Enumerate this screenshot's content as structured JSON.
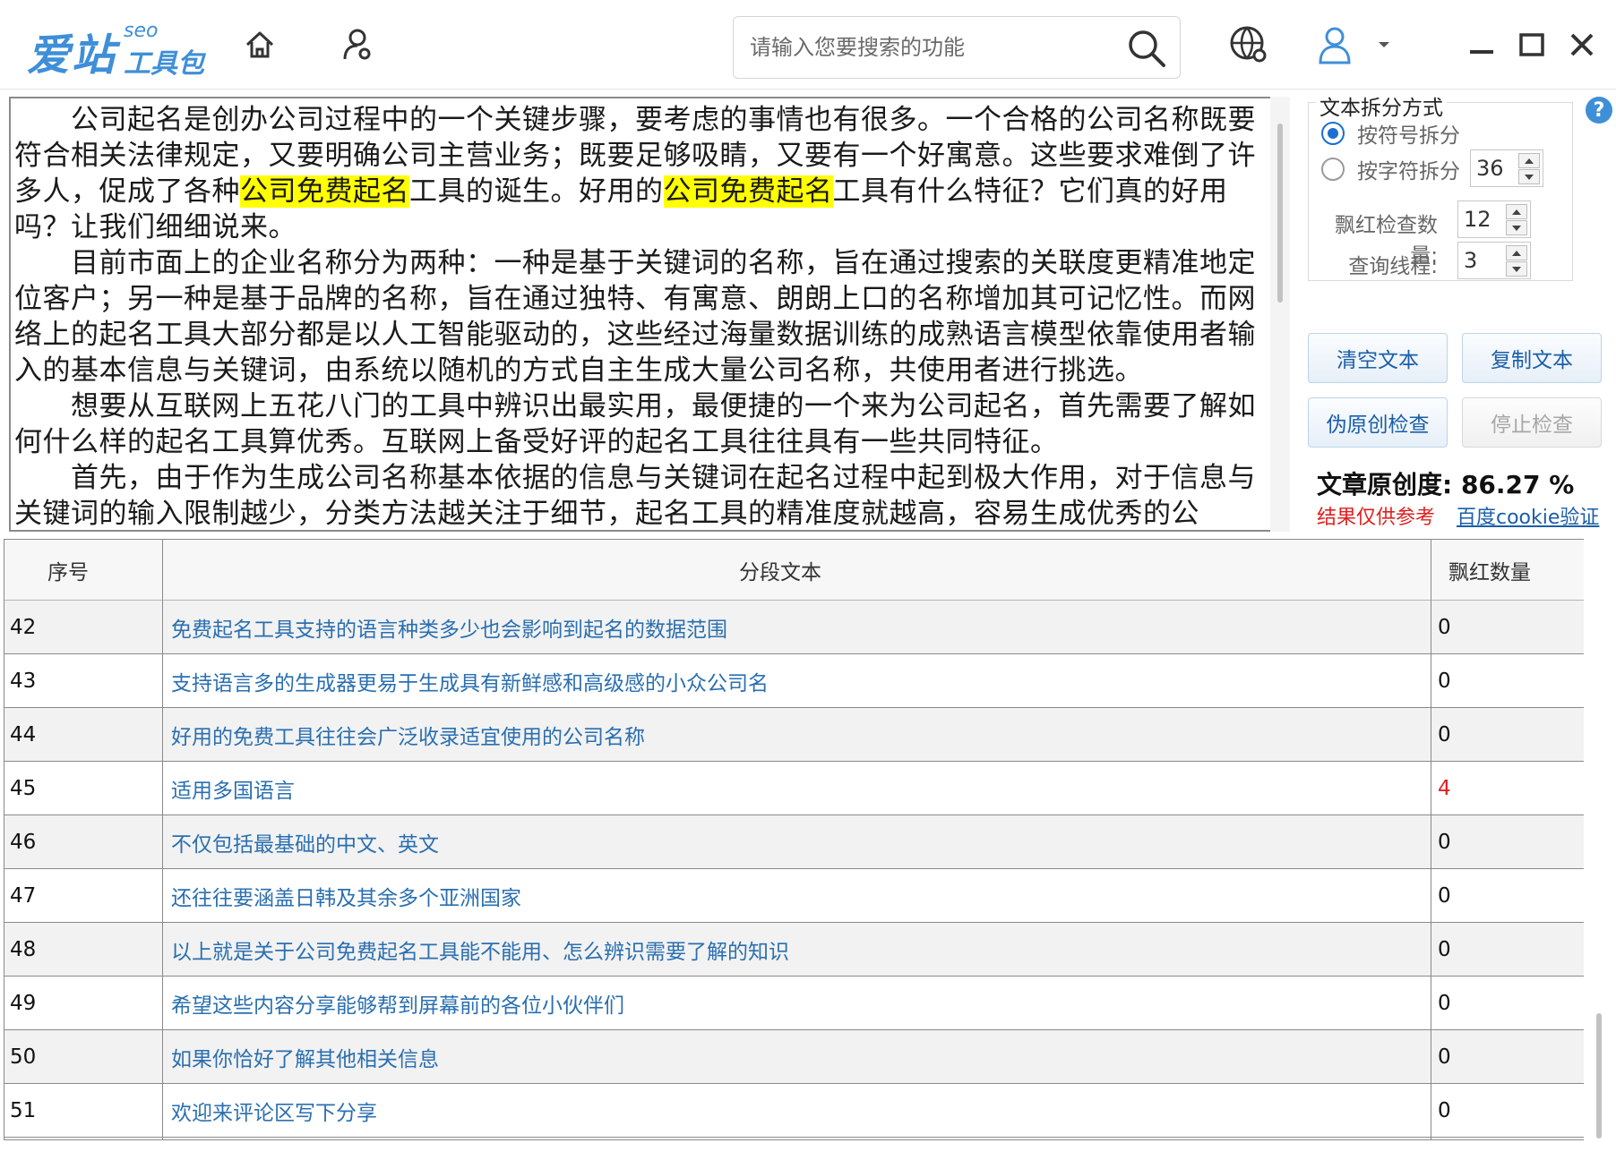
{
  "app": {
    "logo_main": "爱站",
    "logo_seo": "seo",
    "logo_sub": "工具包",
    "search_placeholder": "请输入您要搜索的功能"
  },
  "editor": {
    "paragraphs": [
      [
        "　　公司起名是创办公司过程中的一个关键步骤，要考虑的事情也有很多。一个合格的公司名称既要符合相关法律规定，又要明确公司主营业务；既要足够吸睛，又要有一个好寓意。这些要求难倒了许多人，促成了各种",
        "公司免费起名",
        "工具的诞生。好用的",
        "公司免费起名",
        "工具有什么特征？它们真的好用吗？让我们细细说来。"
      ],
      [
        "　　目前市面上的企业名称分为两种：一种是基于关键词的名称，旨在通过搜索的关联度更精准地定位客户；另一种是基于品牌的名称，旨在通过独特、有寓意、朗朗上口的名称增加其可记忆性。而网络上的起名工具大部分都是以人工智能驱动的，这些经过海量数据训练的成熟语言模型依靠使用者输入的基本信息与关键词，由系统以随机的方式自主生成大量公司名称，共使用者进行挑选。"
      ],
      [
        "　　想要从互联网上五花八门的工具中辨识出最实用，最便捷的一个来为公司起名，首先需要了解如何什么样的起名工具算优秀。互联网上备受好评的起名工具往往具有一些共同特征。"
      ],
      [
        "　　首先，由于作为生成公司名称基本依据的信息与关键词在起名过程中起到极大作用，对于信息与关键词的输入限制越少，分类方法越关注于细节，起名工具的精准度就越高，容易生成优秀的公"
      ]
    ]
  },
  "panel": {
    "split_title": "文本拆分方式",
    "radio_symbol": "按符号拆分",
    "radio_char": "按字符拆分",
    "char_count": "36",
    "check_count_label": "飘红检查数量:",
    "check_count": "12",
    "threads_label": "查询线程:",
    "threads": "3",
    "btn_clear": "清空文本",
    "btn_copy": "复制文本",
    "btn_check": "伪原创检查",
    "btn_stop": "停止检查",
    "originality_label": "文章原创度:",
    "originality_value": "86.27 %",
    "note": "结果仅供参考",
    "cookie_link": "百度cookie验证",
    "help": "?"
  },
  "table": {
    "headers": [
      "序号",
      "分段文本",
      "飘红数量"
    ],
    "rows": [
      {
        "n": "42",
        "text": "免费起名工具支持的语言种类多少也会影响到起名的数据范围",
        "count": "0"
      },
      {
        "n": "43",
        "text": "支持语言多的生成器更易于生成具有新鲜感和高级感的小众公司名",
        "count": "0"
      },
      {
        "n": "44",
        "text": "好用的免费工具往往会广泛收录适宜使用的公司名称",
        "count": "0"
      },
      {
        "n": "45",
        "text": "适用多国语言",
        "count": "4"
      },
      {
        "n": "46",
        "text": "不仅包括最基础的中文、英文",
        "count": "0"
      },
      {
        "n": "47",
        "text": "还往往要涵盖日韩及其余多个亚洲国家",
        "count": "0"
      },
      {
        "n": "48",
        "text": "以上就是关于公司免费起名工具能不能用、怎么辨识需要了解的知识",
        "count": "0"
      },
      {
        "n": "49",
        "text": "希望这些内容分享能够帮到屏幕前的各位小伙伴们",
        "count": "0"
      },
      {
        "n": "50",
        "text": "如果你恰好了解其他相关信息",
        "count": "0"
      },
      {
        "n": "51",
        "text": "欢迎来评论区写下分享",
        "count": "0"
      }
    ]
  },
  "colors": {
    "accent": "#3f8fd8",
    "link": "#2a6fb0",
    "highlight": "#ffff00",
    "warn": "#e02020"
  }
}
